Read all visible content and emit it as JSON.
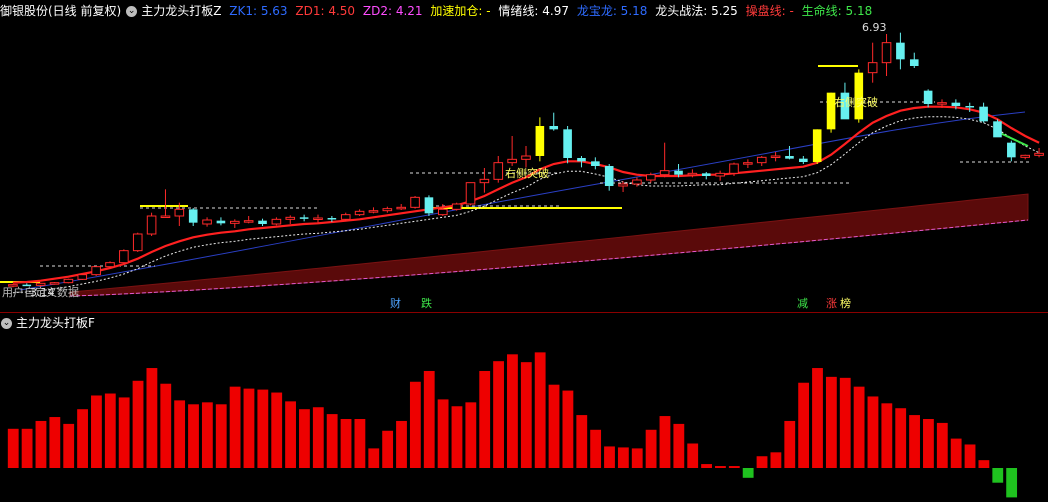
{
  "header": {
    "stock": "御银股份(日线 前复权)",
    "indicator": "主力龙头打板Z",
    "items": [
      {
        "text": "ZK1: 5.63",
        "color": "#2e6bff"
      },
      {
        "text": "ZD1: 4.50",
        "color": "#ff3a3a"
      },
      {
        "text": "ZD2: 4.21",
        "color": "#ff4dff"
      },
      {
        "text": "加速加仓: -",
        "color": "#ffff00"
      },
      {
        "text": "情绪线: 4.97",
        "color": "#ffffff"
      },
      {
        "text": "龙宝龙: 5.18",
        "color": "#2e6bff"
      },
      {
        "text": "龙头战法: 5.25",
        "color": "#ffffff"
      },
      {
        "text": "操盘线: -",
        "color": "#ff3a3a"
      },
      {
        "text": "生命线: 5.18",
        "color": "#3ee64a"
      }
    ]
  },
  "chart": {
    "max_label": "6.93",
    "min_label": "3.14",
    "break_labels": [
      "右侧突破",
      "右侧突破"
    ],
    "bottom_text": "用户自定义数据",
    "event_tags": [
      {
        "text": "财",
        "color": "#4da3ff"
      },
      {
        "text": "跌",
        "color": "#3ee64a"
      },
      {
        "text": "减",
        "color": "#3ee64a"
      },
      {
        "text": "涨",
        "color": "#ff3a3a"
      },
      {
        "text": "榜",
        "color": "#ffff66"
      }
    ]
  },
  "sub_header": {
    "indicator": "主力龙头打板F"
  },
  "colors": {
    "up": "#ff2a2a",
    "down": "#66f0f0",
    "limit": "#ffff00",
    "red_line": "#ff2020",
    "band": "#5a0a0a",
    "grid": "#8a0000"
  },
  "chart_data": {
    "type": "candlestick",
    "candles": [
      [
        3.15,
        3.18,
        3.13,
        3.17
      ],
      [
        3.17,
        3.19,
        3.15,
        3.16
      ],
      [
        3.16,
        3.2,
        3.14,
        3.19
      ],
      [
        3.19,
        3.21,
        3.17,
        3.2
      ],
      [
        3.2,
        3.26,
        3.19,
        3.25
      ],
      [
        3.25,
        3.33,
        3.24,
        3.32
      ],
      [
        3.32,
        3.45,
        3.3,
        3.44
      ],
      [
        3.44,
        3.52,
        3.42,
        3.5
      ],
      [
        3.5,
        3.7,
        3.49,
        3.68
      ],
      [
        3.68,
        3.95,
        3.66,
        3.93
      ],
      [
        3.93,
        4.25,
        3.9,
        4.2
      ],
      [
        4.2,
        4.6,
        4.18,
        4.2
      ],
      [
        4.2,
        4.4,
        4.05,
        4.3
      ],
      [
        4.3,
        4.32,
        4.05,
        4.1
      ],
      [
        4.08,
        4.18,
        4.04,
        4.14
      ],
      [
        4.13,
        4.18,
        4.06,
        4.09
      ],
      [
        4.09,
        4.15,
        4.02,
        4.12
      ],
      [
        4.12,
        4.2,
        4.09,
        4.13
      ],
      [
        4.13,
        4.16,
        4.05,
        4.08
      ],
      [
        4.08,
        4.18,
        4.06,
        4.15
      ],
      [
        4.15,
        4.21,
        4.08,
        4.18
      ],
      [
        4.18,
        4.22,
        4.12,
        4.16
      ],
      [
        4.16,
        4.22,
        4.1,
        4.17
      ],
      [
        4.17,
        4.2,
        4.11,
        4.15
      ],
      [
        4.15,
        4.25,
        4.12,
        4.22
      ],
      [
        4.22,
        4.3,
        4.2,
        4.27
      ],
      [
        4.27,
        4.33,
        4.24,
        4.28
      ],
      [
        4.28,
        4.34,
        4.25,
        4.31
      ],
      [
        4.31,
        4.38,
        4.29,
        4.33
      ],
      [
        4.33,
        4.5,
        4.31,
        4.48
      ],
      [
        4.48,
        4.51,
        4.2,
        4.24
      ],
      [
        4.22,
        4.38,
        4.2,
        4.3
      ],
      [
        4.3,
        4.4,
        4.28,
        4.38
      ],
      [
        4.38,
        4.7,
        4.36,
        4.7
      ],
      [
        4.7,
        4.92,
        4.55,
        4.75
      ],
      [
        4.75,
        5.1,
        4.7,
        5.0
      ],
      [
        5.0,
        5.4,
        4.95,
        5.05
      ],
      [
        5.05,
        5.25,
        4.93,
        5.1
      ],
      [
        5.1,
        5.68,
        5.02,
        5.55
      ],
      [
        5.55,
        5.75,
        5.48,
        5.5
      ],
      [
        5.5,
        5.55,
        4.99,
        5.07
      ],
      [
        5.07,
        5.1,
        4.93,
        5.02
      ],
      [
        5.02,
        5.08,
        4.9,
        4.95
      ],
      [
        4.95,
        4.98,
        4.58,
        4.65
      ],
      [
        4.65,
        4.72,
        4.56,
        4.68
      ],
      [
        4.68,
        4.78,
        4.64,
        4.74
      ],
      [
        4.74,
        4.85,
        4.7,
        4.82
      ],
      [
        4.82,
        5.3,
        4.78,
        4.88
      ],
      [
        4.88,
        4.98,
        4.78,
        4.82
      ],
      [
        4.82,
        4.9,
        4.78,
        4.84
      ],
      [
        4.84,
        4.86,
        4.75,
        4.8
      ],
      [
        4.8,
        4.88,
        4.73,
        4.84
      ],
      [
        4.84,
        5.0,
        4.8,
        4.98
      ],
      [
        4.98,
        5.05,
        4.92,
        5.0
      ],
      [
        5.0,
        5.1,
        4.95,
        5.08
      ],
      [
        5.08,
        5.16,
        5.02,
        5.1
      ],
      [
        5.1,
        5.25,
        5.05,
        5.06
      ],
      [
        5.06,
        5.1,
        4.98,
        5.01
      ],
      [
        5.01,
        5.5,
        4.98,
        5.5
      ],
      [
        5.5,
        6.05,
        5.45,
        6.05
      ],
      [
        6.05,
        6.2,
        5.8,
        5.65
      ],
      [
        5.65,
        6.4,
        5.6,
        6.35
      ],
      [
        6.35,
        6.8,
        6.2,
        6.5
      ],
      [
        6.5,
        6.93,
        6.3,
        6.8
      ],
      [
        6.8,
        6.95,
        6.4,
        6.55
      ],
      [
        6.55,
        6.65,
        6.42,
        6.45
      ],
      [
        6.08,
        6.1,
        5.83,
        5.88
      ],
      [
        5.88,
        5.95,
        5.82,
        5.9
      ],
      [
        5.9,
        5.95,
        5.8,
        5.85
      ],
      [
        5.85,
        5.9,
        5.76,
        5.84
      ],
      [
        5.84,
        5.9,
        5.6,
        5.62
      ],
      [
        5.62,
        5.65,
        5.4,
        5.38
      ],
      [
        5.3,
        5.33,
        5.02,
        5.08
      ],
      [
        5.08,
        5.12,
        5.05,
        5.11
      ],
      [
        5.11,
        5.22,
        5.08,
        5.14
      ]
    ],
    "red_line": [
      3.2,
      3.21,
      3.23,
      3.26,
      3.29,
      3.33,
      3.37,
      3.42,
      3.48,
      3.56,
      3.66,
      3.75,
      3.82,
      3.88,
      3.92,
      3.95,
      3.97,
      4.0,
      4.02,
      4.04,
      4.06,
      4.08,
      4.09,
      4.11,
      4.13,
      4.15,
      4.18,
      4.21,
      4.24,
      4.27,
      4.3,
      4.33,
      4.36,
      4.42,
      4.5,
      4.6,
      4.7,
      4.78,
      4.9,
      4.98,
      5.02,
      5.02,
      4.98,
      4.93,
      4.86,
      4.82,
      4.8,
      4.8,
      4.8,
      4.81,
      4.82,
      4.82,
      4.84,
      4.86,
      4.88,
      4.9,
      4.92,
      4.94,
      5.0,
      5.12,
      5.28,
      5.45,
      5.6,
      5.7,
      5.78,
      5.82,
      5.84,
      5.84,
      5.83,
      5.8,
      5.75,
      5.65,
      5.52,
      5.4,
      5.3
    ],
    "histogram": [
      4.0,
      4.0,
      4.8,
      5.2,
      4.5,
      6.0,
      7.4,
      7.6,
      7.2,
      8.9,
      10.2,
      8.6,
      6.9,
      6.5,
      6.7,
      6.5,
      8.3,
      8.1,
      8.0,
      7.7,
      6.8,
      6.0,
      6.2,
      5.5,
      5.0,
      5.0,
      2.0,
      3.8,
      4.8,
      8.8,
      9.9,
      7.0,
      6.3,
      6.7,
      9.9,
      10.9,
      11.6,
      10.8,
      11.8,
      8.5,
      7.9,
      5.4,
      3.9,
      2.2,
      2.1,
      2.0,
      3.9,
      5.3,
      4.5,
      2.5,
      0.4,
      0.2,
      0.2,
      -1.0,
      1.2,
      1.6,
      4.8,
      8.7,
      10.2,
      9.3,
      9.2,
      8.3,
      7.3,
      6.6,
      6.1,
      5.4,
      5.0,
      4.6,
      3.0,
      2.4,
      0.8,
      -1.5,
      -3.0
    ]
  }
}
